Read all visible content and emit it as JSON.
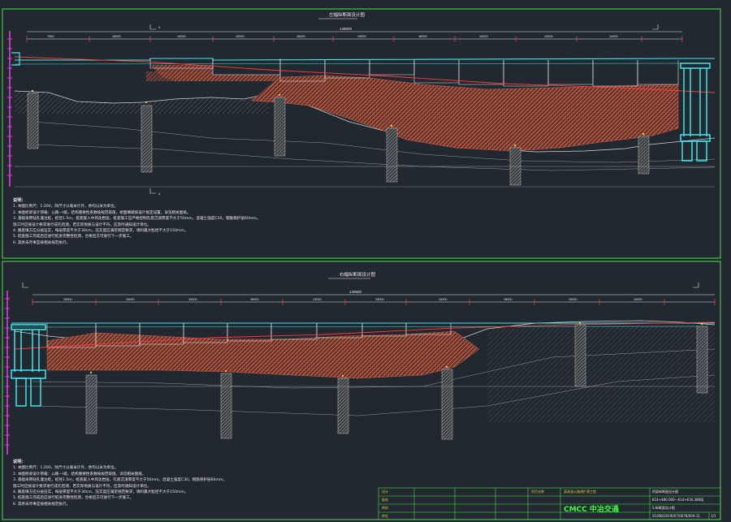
{
  "colors": {
    "background": "#212830",
    "frame": "#4ee04e",
    "structure": "#3fe6ea",
    "grade_line": "#ff3b3b",
    "fill_hatch": "#c8624e",
    "pile": "#b9b9b9",
    "ground": "#cfcfcf",
    "text": "#e8e8e8",
    "accent": "#e8c23a"
  },
  "upper": {
    "title": "左幅纵断面设计图",
    "total_length": "148000",
    "span_lengths": [
      "7000",
      "16000",
      "14000",
      "15000",
      "16000",
      "13000",
      "18000",
      "15000",
      "13000",
      "14000"
    ],
    "section_mark": "4",
    "notes_title": "说明：",
    "notes": [
      "1. 本图比例尺：1:200，除尺寸以毫米计外，余均以米为单位。",
      "2. 本图桥梁设计荷载：公路—I级，结构重要性系数按规范取值，桥面横坡按设计规定设置，详见相关图纸。",
      "3. 基础采用钻孔灌注桩，桩径1.5m，桩底嵌入中风化岩层，桩基施工应严格控制孔底沉渣厚度不大于50mm，混凝土强度C30，钢筋保护层60mm。",
      "   施工时应按设计要求进行成孔检测，若实际地质与设计不符，应及时通知设计单位。",
      "4. 路基填方应分层压实，每层厚度不大于30cm，压实度应满足规范要求，填料最大粒径不大于150mm。",
      "5. 桩基施工完成后应进行桩身完整性检测，合格后方可进行下一步施工。",
      "6. 其余未尽事宜按相关规范执行。"
    ]
  },
  "lower": {
    "title": "右幅纵断面设计图",
    "total_length": "149500",
    "span_lengths": [
      "16000",
      "15000",
      "15000",
      "16000",
      "13000",
      "15000",
      "14000",
      "16000",
      "15000",
      "14500"
    ],
    "notes_title": "说明：",
    "notes": [
      "1. 本图比例尺：1:200，除尺寸以毫米计外，余均以米为单位。",
      "2. 本图桥梁设计荷载：公路—I级，结构重要性系数按规范取值，详见相关图纸。",
      "3. 基础采用钻孔灌注桩，桩径1.5m，桩底嵌入中风化岩层，孔底沉渣厚度不大于50mm，混凝土强度C30，钢筋保护层60mm。",
      "   施工时应按设计要求进行成孔检测，若实际地质与设计不符，应及时通知设计单位。",
      "4. 路基填方应分层压实，每层厚度不大于30cm，压实度应满足规范要求，填料最大粒径不大于150mm。",
      "5. 桩基施工完成后应进行桩身完整性检测，合格后方可进行下一步施工。",
      "6. 其余未尽事宜按相关规范执行。"
    ]
  },
  "title_block": {
    "designer": "设计",
    "checker": "复核",
    "reviewer": "审核",
    "approver": "审定",
    "project_label": "项目名称",
    "project_name": "某高速公路改扩建工程",
    "drawing_name": "桥梁纵断面设计图",
    "stake_range": "K14+480.000—K14+634.380段",
    "sheet_title": "S 纵断面设计图",
    "logo": "CMCC 中冶交通",
    "drawing_no": "S1008/2019007/0078/004-11",
    "revision": "A",
    "sheet": "1/1"
  }
}
